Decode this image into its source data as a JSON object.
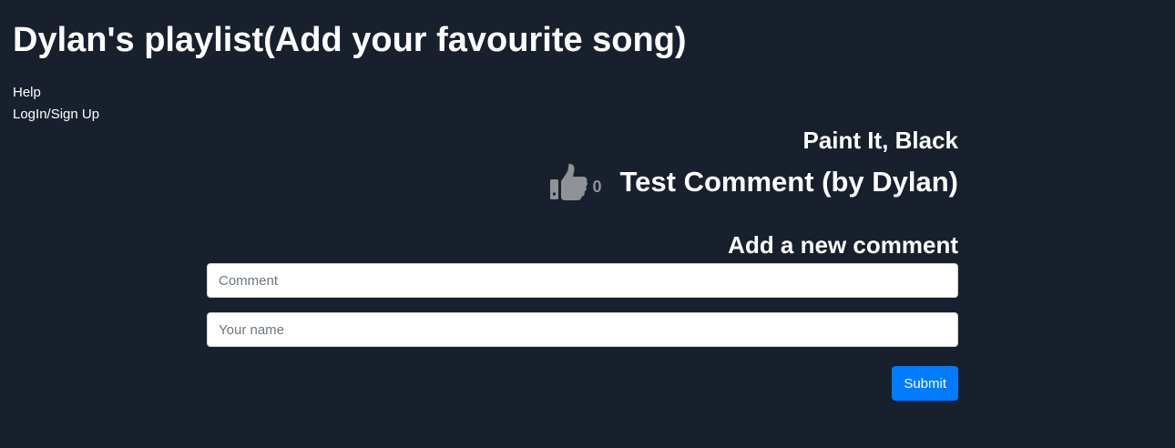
{
  "header": {
    "title": "Dylan's playlist(Add your favourite song)"
  },
  "nav": {
    "items": [
      {
        "label": "Help"
      },
      {
        "label": "LogIn/Sign Up"
      }
    ]
  },
  "song": {
    "title": "Paint It, Black",
    "comments": [
      {
        "text": "Test Comment (by Dylan)",
        "likes": "0",
        "like_icon": "thumbs-up-icon"
      }
    ]
  },
  "new_comment": {
    "heading": "Add a new comment",
    "comment_placeholder": "Comment",
    "comment_value": "",
    "name_placeholder": "Your name",
    "name_value": "",
    "submit_label": "Submit"
  },
  "colors": {
    "background": "#17202c",
    "text": "#ffffff",
    "like_icon": "#8f9296",
    "submit": "#007bff"
  }
}
